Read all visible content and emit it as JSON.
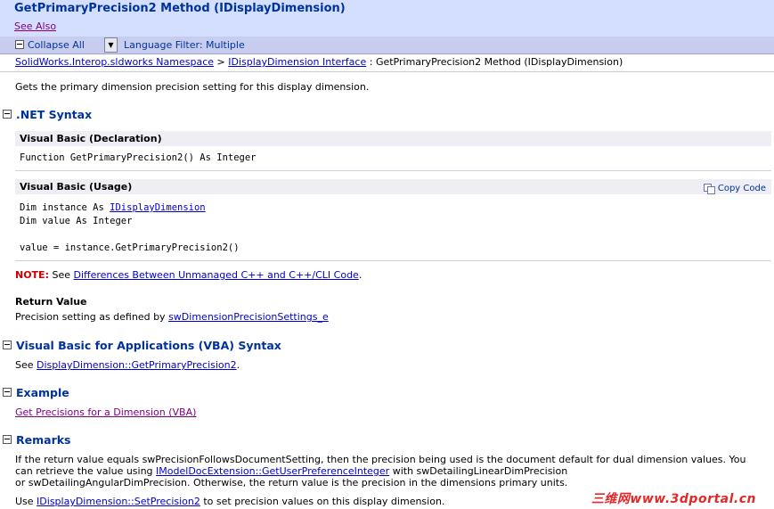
{
  "header": {
    "title": "GetPrimaryPrecision2 Method (IDisplayDimension)",
    "see_also": "See Also"
  },
  "toolbar": {
    "collapse_all": "Collapse All",
    "language_filter": "Language Filter: Multiple"
  },
  "breadcrumb": {
    "namespace": "SolidWorks.Interop.sldworks Namespace",
    "sep1": ">",
    "interface": "IDisplayDimension Interface",
    "current": ": GetPrimaryPrecision2 Method (IDisplayDimension)"
  },
  "summary": "Gets the primary dimension precision setting for this display dimension.",
  "net_syntax": {
    "heading": ".NET Syntax",
    "declaration": {
      "label": "Visual Basic (Declaration)",
      "code": "Function GetPrimaryPrecision2() As Integer"
    },
    "usage": {
      "label": "Visual Basic (Usage)",
      "copy": "Copy Code",
      "line1_prefix": "Dim instance As ",
      "line1_link": "IDisplayDimension",
      "line2": "Dim value As Integer",
      "line3": "value = instance.GetPrimaryPrecision2()"
    },
    "note": {
      "label": "NOTE:",
      "prefix": " See ",
      "link": "Differences Between Unmanaged C++ and C++/CLI Code",
      "suffix": "."
    },
    "return_value": {
      "title": "Return Value",
      "prefix": "Precision setting as defined by ",
      "link": "swDimensionPrecisionSettings_e"
    }
  },
  "vba": {
    "heading": "Visual Basic for Applications (VBA) Syntax",
    "prefix": "See ",
    "link": "DisplayDimension::GetPrimaryPrecision2",
    "suffix": "."
  },
  "example": {
    "heading": "Example",
    "link": "Get Precisions for a Dimension (VBA)"
  },
  "remarks": {
    "heading": "Remarks",
    "line1": "If the return value equals swPrecisionFollowsDocumentSetting, then the precision being used is the document default for dual dimension values. You",
    "line2_prefix": "can retrieve the value using ",
    "line2_link": "IModelDocExtension::GetUserPreferenceInteger",
    "line2_suffix": " with swDetailingLinearDimPrecision",
    "line3": "or swDetailingAngularDimPrecision. Otherwise, the return value is the precision in the dimensions primary units.",
    "use_prefix": "Use ",
    "use_link": "IDisplayDimension::SetPrecision2",
    "use_suffix": " to set precision values on this display dimension."
  },
  "watermark": "三维网www.3dportal.cn"
}
